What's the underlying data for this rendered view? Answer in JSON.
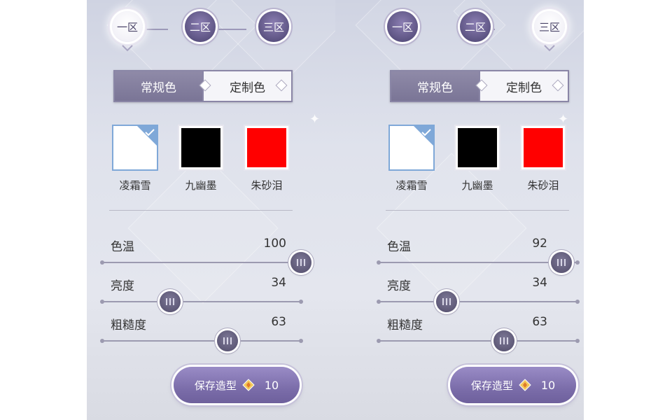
{
  "zones": [
    "一区",
    "二区",
    "三区"
  ],
  "tabs": {
    "regular": "常规色",
    "custom": "定制色"
  },
  "swatches": [
    {
      "name": "凌霜雪",
      "color": "#ffffff"
    },
    {
      "name": "九幽墨",
      "color": "#000000"
    },
    {
      "name": "朱砂泪",
      "color": "#ff0000"
    }
  ],
  "slider_labels": {
    "temperature": "色温",
    "brightness": "亮度",
    "roughness": "粗糙度"
  },
  "save": {
    "label": "保存造型",
    "cost": "10",
    "icon": "gem-icon"
  },
  "accent": "#7b6daa",
  "panels": [
    {
      "active_zone": 0,
      "selected_swatch": 0,
      "temperature": "100",
      "brightness": "34",
      "roughness": "63",
      "temperature_level": 1.0,
      "brightness_level": 0.34,
      "roughness_level": 0.63
    },
    {
      "active_zone": 2,
      "selected_swatch": 0,
      "temperature": "92",
      "brightness": "34",
      "roughness": "63",
      "temperature_level": 0.92,
      "brightness_level": 0.34,
      "roughness_level": 0.63
    }
  ]
}
